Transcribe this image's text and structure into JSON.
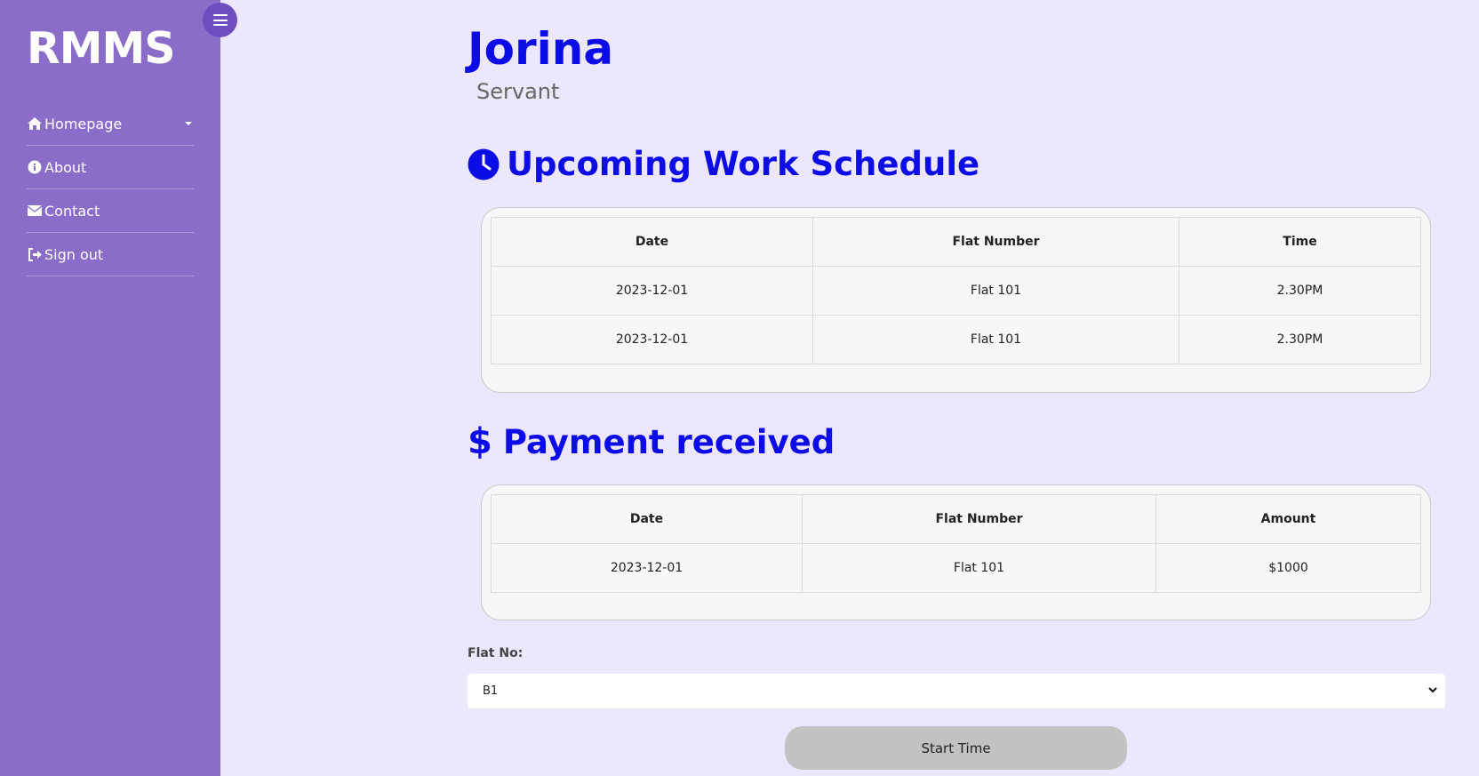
{
  "sidebar": {
    "logo": "RMMS",
    "items": [
      {
        "label": "Homepage",
        "icon": "home-icon"
      },
      {
        "label": "About",
        "icon": "info-icon"
      },
      {
        "label": "Contact",
        "icon": "envelope-icon"
      },
      {
        "label": "Sign out",
        "icon": "sign-out-icon"
      }
    ]
  },
  "profile": {
    "name": "Jorina",
    "role": "Servant"
  },
  "schedule": {
    "title": "Upcoming Work Schedule",
    "icon": "clock-icon",
    "headers": [
      "Date",
      "Flat Number",
      "Time"
    ],
    "rows": [
      [
        "2023-12-01",
        "Flat 101",
        "2.30PM"
      ],
      [
        "2023-12-01",
        "Flat 101",
        "2.30PM"
      ]
    ]
  },
  "payment": {
    "title": "Payment received",
    "icon": "dollar-icon",
    "headers": [
      "Date",
      "Flat Number",
      "Amount"
    ],
    "rows": [
      [
        "2023-12-01",
        "Flat 101",
        "$1000"
      ]
    ]
  },
  "form": {
    "flat_label": "Flat No:",
    "flat_selected": "B1",
    "start_button": "Start Time"
  },
  "colors": {
    "background": "#ede7fd",
    "sidebar": "#8a6dc9",
    "accent": "#0c0de6",
    "button": "#c2c2c2"
  }
}
